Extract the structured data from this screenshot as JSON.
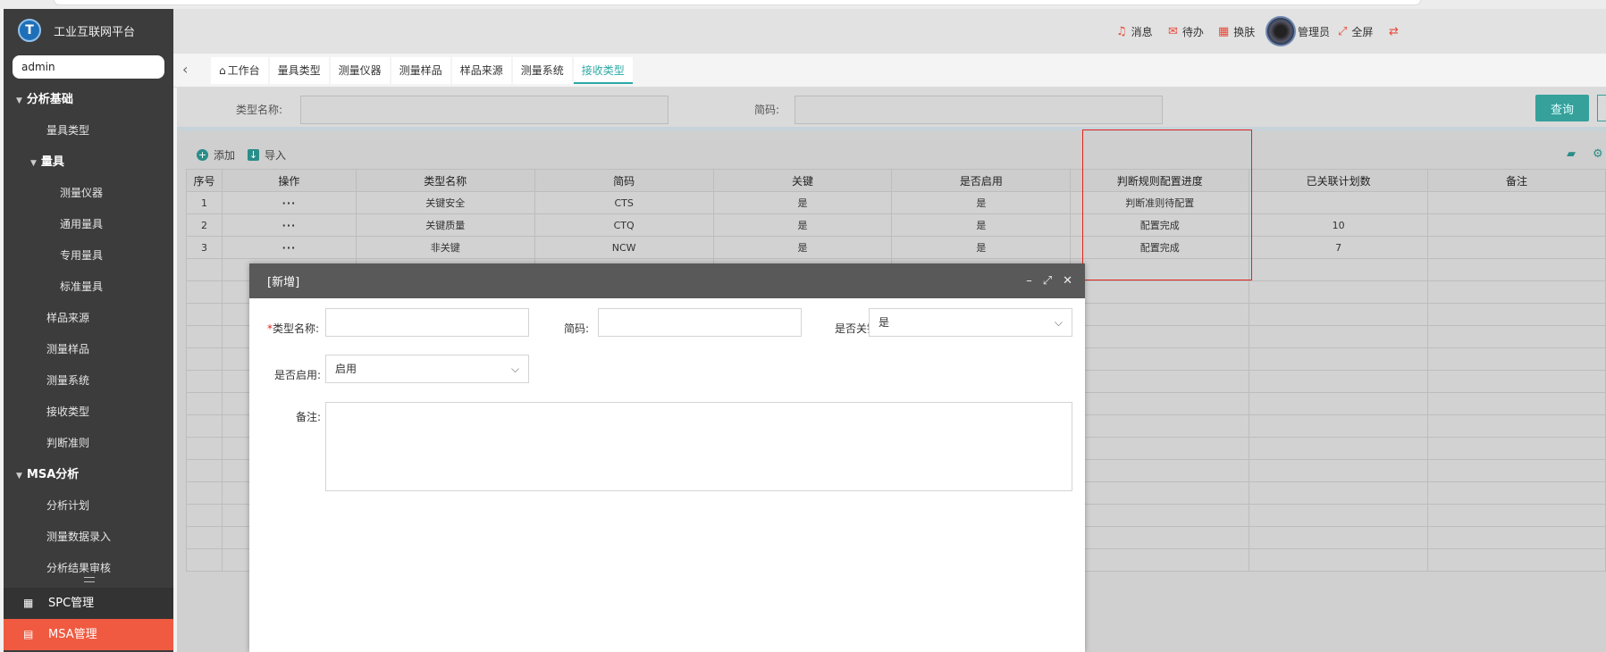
{
  "app": {
    "title": "工业互联网平台",
    "logo_letter": "T",
    "user": "admin"
  },
  "sidebar": {
    "items": [
      {
        "label": "分析基础",
        "level": "group",
        "caret": true
      },
      {
        "label": "量具类型",
        "level": "l1"
      },
      {
        "label": "量具",
        "level": "group1",
        "caret": true
      },
      {
        "label": "测量仪器",
        "level": "l2"
      },
      {
        "label": "通用量具",
        "level": "l2"
      },
      {
        "label": "专用量具",
        "level": "l2"
      },
      {
        "label": "标准量具",
        "level": "l2"
      },
      {
        "label": "样品来源",
        "level": "l1"
      },
      {
        "label": "测量样品",
        "level": "l1"
      },
      {
        "label": "测量系统",
        "level": "l1"
      },
      {
        "label": "接收类型",
        "level": "l1"
      },
      {
        "label": "判断准则",
        "level": "l1"
      },
      {
        "label": "MSA分析",
        "level": "group",
        "caret": true
      },
      {
        "label": "分析计划",
        "level": "l1"
      },
      {
        "label": "测量数据录入",
        "level": "l1"
      },
      {
        "label": "分析结果审核",
        "level": "l1"
      }
    ],
    "bottom": {
      "spc": "SPC管理",
      "msa": "MSA管理"
    }
  },
  "header": {
    "message": "消息",
    "todo": "待办",
    "skin": "换肤",
    "admin": "管理员",
    "fullscreen": "全屏"
  },
  "tabs": [
    "工作台",
    "量具类型",
    "测量仪器",
    "测量样品",
    "样品来源",
    "测量系统",
    "接收类型"
  ],
  "search": {
    "type_name_label": "类型名称:",
    "code_label": "简码:",
    "query_button": "查询"
  },
  "toolbar": {
    "add": "添加",
    "import": "导入"
  },
  "table": {
    "columns": [
      "序号",
      "操作",
      "类型名称",
      "简码",
      "关键",
      "是否启用",
      "判断规则配置进度",
      "已关联计划数",
      "备注"
    ],
    "rows": [
      [
        "1",
        "···",
        "关键安全",
        "CTS",
        "是",
        "是",
        "判断准则待配置",
        "",
        ""
      ],
      [
        "2",
        "···",
        "关键质量",
        "CTQ",
        "是",
        "是",
        "配置完成",
        "10",
        ""
      ],
      [
        "3",
        "···",
        "非关键",
        "NCW",
        "是",
        "是",
        "配置完成",
        "7",
        ""
      ]
    ]
  },
  "modal": {
    "title": "[新增]",
    "type_name_label": "类型名称:",
    "code_label": "简码:",
    "key_label": "是否关键:",
    "key_value": "是",
    "enabled_label": "是否启用:",
    "enabled_value": "启用",
    "remark_label": "备注:"
  },
  "colors": {
    "accent": "#2da9a4",
    "brand_red": "#f05a41",
    "highlight_box": "#e2231a"
  }
}
